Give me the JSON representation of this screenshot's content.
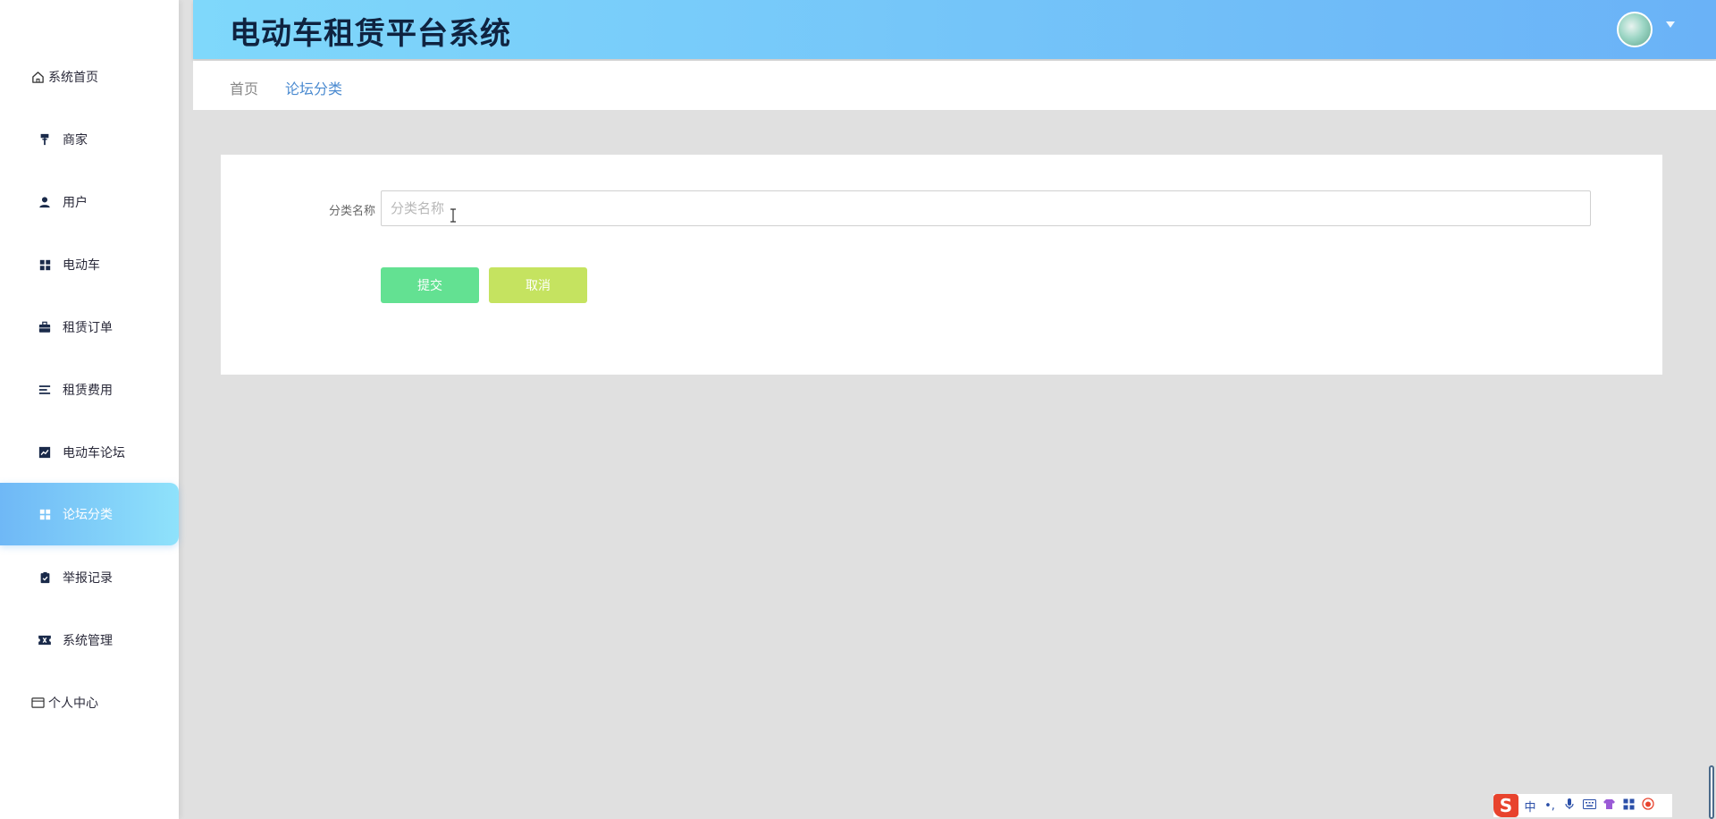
{
  "app": {
    "title": "电动车租赁平台系统"
  },
  "sidebar": {
    "items": [
      {
        "label": "系统首页",
        "icon": "home-icon"
      },
      {
        "label": "商家",
        "icon": "paint-roller-icon"
      },
      {
        "label": "用户",
        "icon": "user-icon"
      },
      {
        "label": "电动车",
        "icon": "grid-icon"
      },
      {
        "label": "租赁订单",
        "icon": "briefcase-icon"
      },
      {
        "label": "租赁费用",
        "icon": "list-icon"
      },
      {
        "label": "电动车论坛",
        "icon": "chart-icon"
      },
      {
        "label": "论坛分类",
        "icon": "grid-icon",
        "active": true
      },
      {
        "label": "举报记录",
        "icon": "clipboard-check-icon"
      },
      {
        "label": "系统管理",
        "icon": "ticket-icon"
      },
      {
        "label": "个人中心",
        "icon": "wallet-icon"
      }
    ]
  },
  "breadcrumb": {
    "home": "首页",
    "current": "论坛分类"
  },
  "form": {
    "field_label": "分类名称",
    "field_placeholder": "分类名称",
    "field_value": "",
    "submit_label": "提交",
    "cancel_label": "取消"
  },
  "ime": {
    "logo": "S",
    "lang": "中",
    "punct": "•,",
    "items": [
      "mic-icon",
      "keyboard-icon",
      "shirt-icon",
      "grid-icon",
      "face-icon"
    ]
  },
  "colors": {
    "header_gradient_start": "#7fd8fb",
    "header_gradient_end": "#6ab2f7",
    "active_menu_start": "#6fb8f6",
    "active_menu_end": "#8fe2fb",
    "submit_button": "#63e192",
    "cancel_button": "#c5e360",
    "breadcrumb_active": "#4a8ad0",
    "page_background": "#e0e0e0"
  }
}
